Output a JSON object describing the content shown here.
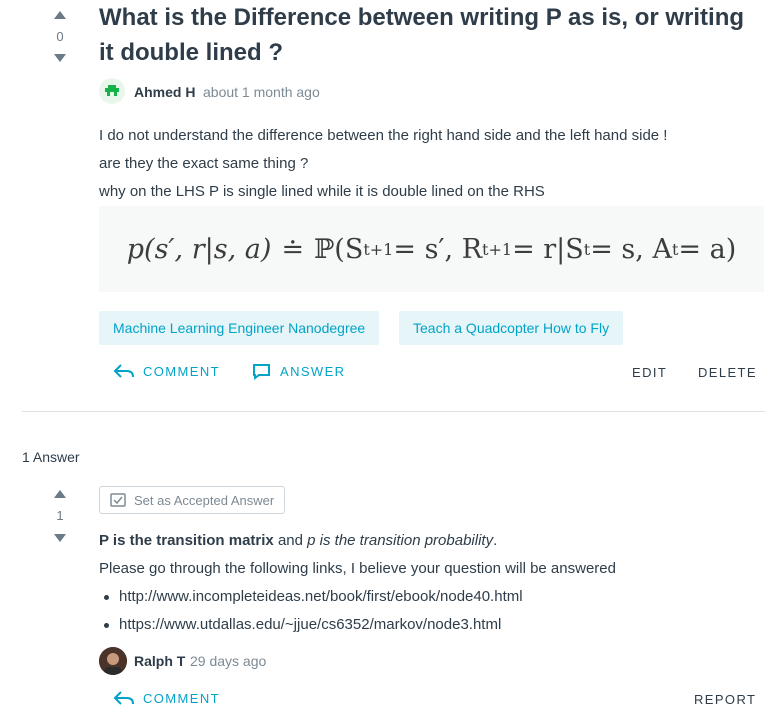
{
  "question": {
    "votes": "0",
    "title": "What is the Difference between writing P as is, or writing it double lined ?",
    "author": "Ahmed H",
    "time": "about 1 month ago",
    "body": [
      "I do not understand the difference between the right hand side and the left hand side !",
      "are they the exact same thing ?",
      "why on the LHS P is single lined while it is double lined on the RHS"
    ],
    "formula": {
      "lhs": "p(s′, r|s, a)",
      "eq": "≐",
      "rhs_a": "ℙ(S",
      "sub1": "t+1",
      "rhs_b": " = s′, R",
      "sub2": "t+1",
      "rhs_c": " = r|S",
      "sub3": "t",
      "rhs_d": " = s, A",
      "sub4": "t",
      "rhs_e": " = a)"
    },
    "tags": [
      "Machine Learning Engineer Nanodegree",
      "Teach a Quadcopter How to Fly"
    ],
    "actions": {
      "comment": "COMMENT",
      "answer": "ANSWER",
      "edit": "EDIT",
      "delete": "DELETE"
    }
  },
  "answers_label": "1 Answer",
  "answer": {
    "votes": "1",
    "accept_label": "Set as Accepted Answer",
    "line1_bold": "P is the transition matrix",
    "line1_mid": " and ",
    "line1_italic": "p is the transition probability",
    "line1_end": ".",
    "line2": "Please go through the following links, I believe your question will be answered",
    "links": [
      "http://www.incompleteideas.net/book/first/ebook/node40.html",
      "https://www.utdallas.edu/~jjue/cs6352/markov/node3.html"
    ],
    "author": "Ralph T",
    "time": "29 days ago",
    "actions": {
      "comment": "COMMENT",
      "report": "REPORT"
    }
  },
  "colors": {
    "accent": "#02a3c9",
    "text": "#2e3d49",
    "muted": "#7d8a94",
    "tag_bg": "#e6f5f8"
  }
}
